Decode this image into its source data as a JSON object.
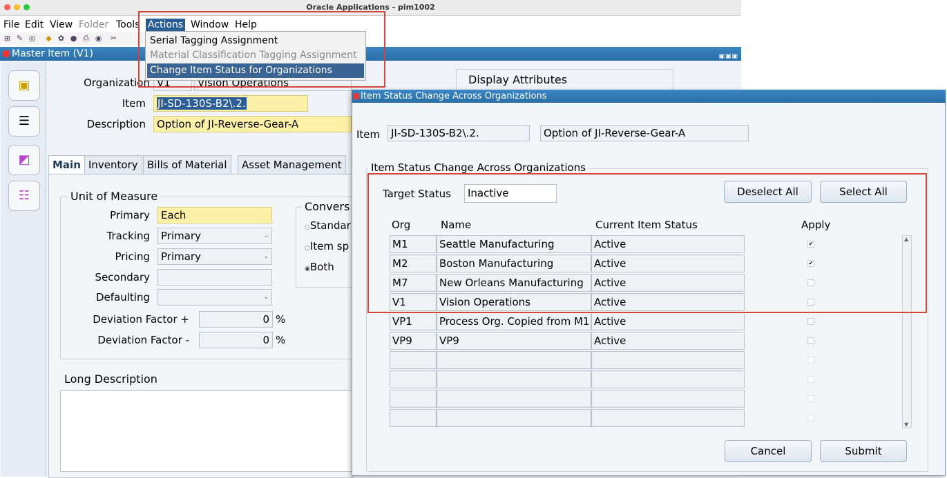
{
  "window": {
    "title": "Oracle Applications - pim1002"
  },
  "menubar": {
    "file": "File",
    "edit": "Edit",
    "view": "View",
    "folder": "Folder",
    "tools": "Tools",
    "actions": "Actions",
    "window": "Window",
    "help": "Help"
  },
  "actions_menu": {
    "items": [
      {
        "label": "Serial Tagging Assignment"
      },
      {
        "label": "Material Classification Tagging Assignment"
      },
      {
        "label": "Change Item Status for Organizations"
      }
    ]
  },
  "master": {
    "title": "Master Item (V1)",
    "organization_label": "Organization",
    "organization_code": "V1",
    "organization_name": "Vision Operations",
    "item_label": "Item",
    "item_value": "JI-SD-130S-B2\\.2.",
    "description_label": "Description",
    "description_value": "Option of  JI-Reverse-Gear-A",
    "display_attributes": "Display Attributes",
    "tabs": [
      "Main",
      "Inventory",
      "Bills of Material",
      "Asset Management"
    ],
    "uom": {
      "header": "Unit of Measure",
      "primary_label": "Primary",
      "primary_value": "Each",
      "tracking_label": "Tracking",
      "tracking_value": "Primary",
      "pricing_label": "Pricing",
      "pricing_value": "Primary",
      "secondary_label": "Secondary",
      "secondary_value": "",
      "defaulting_label": "Defaulting",
      "defaulting_value": "",
      "dev_plus_label": "Deviation Factor +",
      "dev_plus_value": "0",
      "dev_minus_label": "Deviation Factor -",
      "dev_minus_value": "0",
      "percent": "%"
    },
    "conversion": {
      "header": "Convers",
      "opt_standard": "Standar",
      "opt_item_specific": "Item sp",
      "opt_both": "Both"
    },
    "long_description_label": "Long Description"
  },
  "dialog": {
    "title": "Item Status Change Across Organizations",
    "item_label": "Item",
    "item_value": "JI-SD-130S-B2\\.2.",
    "description_value": "Option of  JI-Reverse-Gear-A",
    "group_header": "Item Status Change Across Organizations",
    "target_status_label": "Target Status",
    "target_status_value": "Inactive",
    "deselect_all": "Deselect All",
    "select_all": "Select All",
    "columns": {
      "org": "Org",
      "name": "Name",
      "status": "Current Item Status",
      "apply": "Apply"
    },
    "rows": [
      {
        "org": "M1",
        "name": "Seattle Manufacturing",
        "status": "Active",
        "apply": true
      },
      {
        "org": "M2",
        "name": "Boston Manufacturing",
        "status": "Active",
        "apply": true
      },
      {
        "org": "M7",
        "name": "New Orleans Manufacturing",
        "status": "Active",
        "apply": false
      },
      {
        "org": "V1",
        "name": "Vision Operations",
        "status": "Active",
        "apply": false
      },
      {
        "org": "VP1",
        "name": "Process Org. Copied from M1",
        "status": "Active",
        "apply": false
      },
      {
        "org": "VP9",
        "name": "VP9",
        "status": "Active",
        "apply": false
      },
      {
        "org": "",
        "name": "",
        "status": "",
        "apply": false
      },
      {
        "org": "",
        "name": "",
        "status": "",
        "apply": false
      },
      {
        "org": "",
        "name": "",
        "status": "",
        "apply": false
      },
      {
        "org": "",
        "name": "",
        "status": "",
        "apply": false
      }
    ],
    "cancel": "Cancel",
    "submit": "Submit"
  },
  "colors": {
    "titlebar_blue": "#2a6ea6",
    "highlight": "#2a5d96",
    "required_yellow": "#fdf1a8",
    "annotation_red": "#d9443a"
  }
}
